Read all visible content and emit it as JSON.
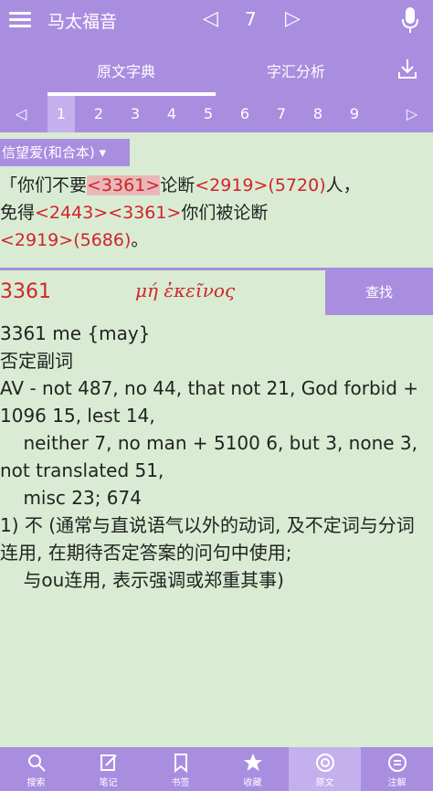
{
  "topbar": {
    "book": "马太福音",
    "chapter": "7"
  },
  "tabs": [
    {
      "label": "原文字典"
    },
    {
      "label": "字汇分析"
    }
  ],
  "pager": {
    "pages": [
      "1",
      "2",
      "3",
      "4",
      "5",
      "6",
      "7",
      "8",
      "9"
    ],
    "active": "1"
  },
  "verse": {
    "version": "信望爱(和合本) ▾",
    "segments": [
      {
        "t": "「你们不要",
        "k": "text"
      },
      {
        "t": "<3361>",
        "k": "hl"
      },
      {
        "t": "论断",
        "k": "text"
      },
      {
        "t": "<2919>(5720)",
        "k": "num"
      },
      {
        "t": "人，",
        "k": "text"
      },
      {
        "t": "免得",
        "k": "text"
      },
      {
        "t": "<2443><3361>",
        "k": "num"
      },
      {
        "t": "你们被论断",
        "k": "text"
      },
      {
        "t": "<2919>(5686)",
        "k": "num"
      },
      {
        "t": "。",
        "k": "text"
      }
    ]
  },
  "entry": {
    "number": "3361",
    "greek": "μή ἐκεῖνος",
    "search_label": "查找",
    "lines": [
      "3361 me {may}",
      "",
      "否定副词",
      "",
      "AV - not 487, no 44, that not 21, God forbid + 1096 15, lest 14,",
      "    neither 7, no man + 5100 6, but 3, none 3, not translated 51,",
      "    misc 23; 674",
      "",
      "1) 不 (通常与直说语气以外的动词, 及不定词与分词连用, 在期待否定答案的问句中使用;",
      "    与ou连用, 表示强调或郑重其事)"
    ]
  },
  "bottom_nav": [
    {
      "label": "搜索",
      "icon": "search-icon"
    },
    {
      "label": "笔记",
      "icon": "note-icon"
    },
    {
      "label": "书签",
      "icon": "bookmark-icon"
    },
    {
      "label": "收藏",
      "icon": "star-icon"
    },
    {
      "label": "原文",
      "icon": "original-icon"
    },
    {
      "label": "注解",
      "icon": "commentary-icon"
    }
  ],
  "colors": {
    "accent": "#a98ee0",
    "background": "#d9ecd3",
    "strong_red": "#d2232a"
  }
}
